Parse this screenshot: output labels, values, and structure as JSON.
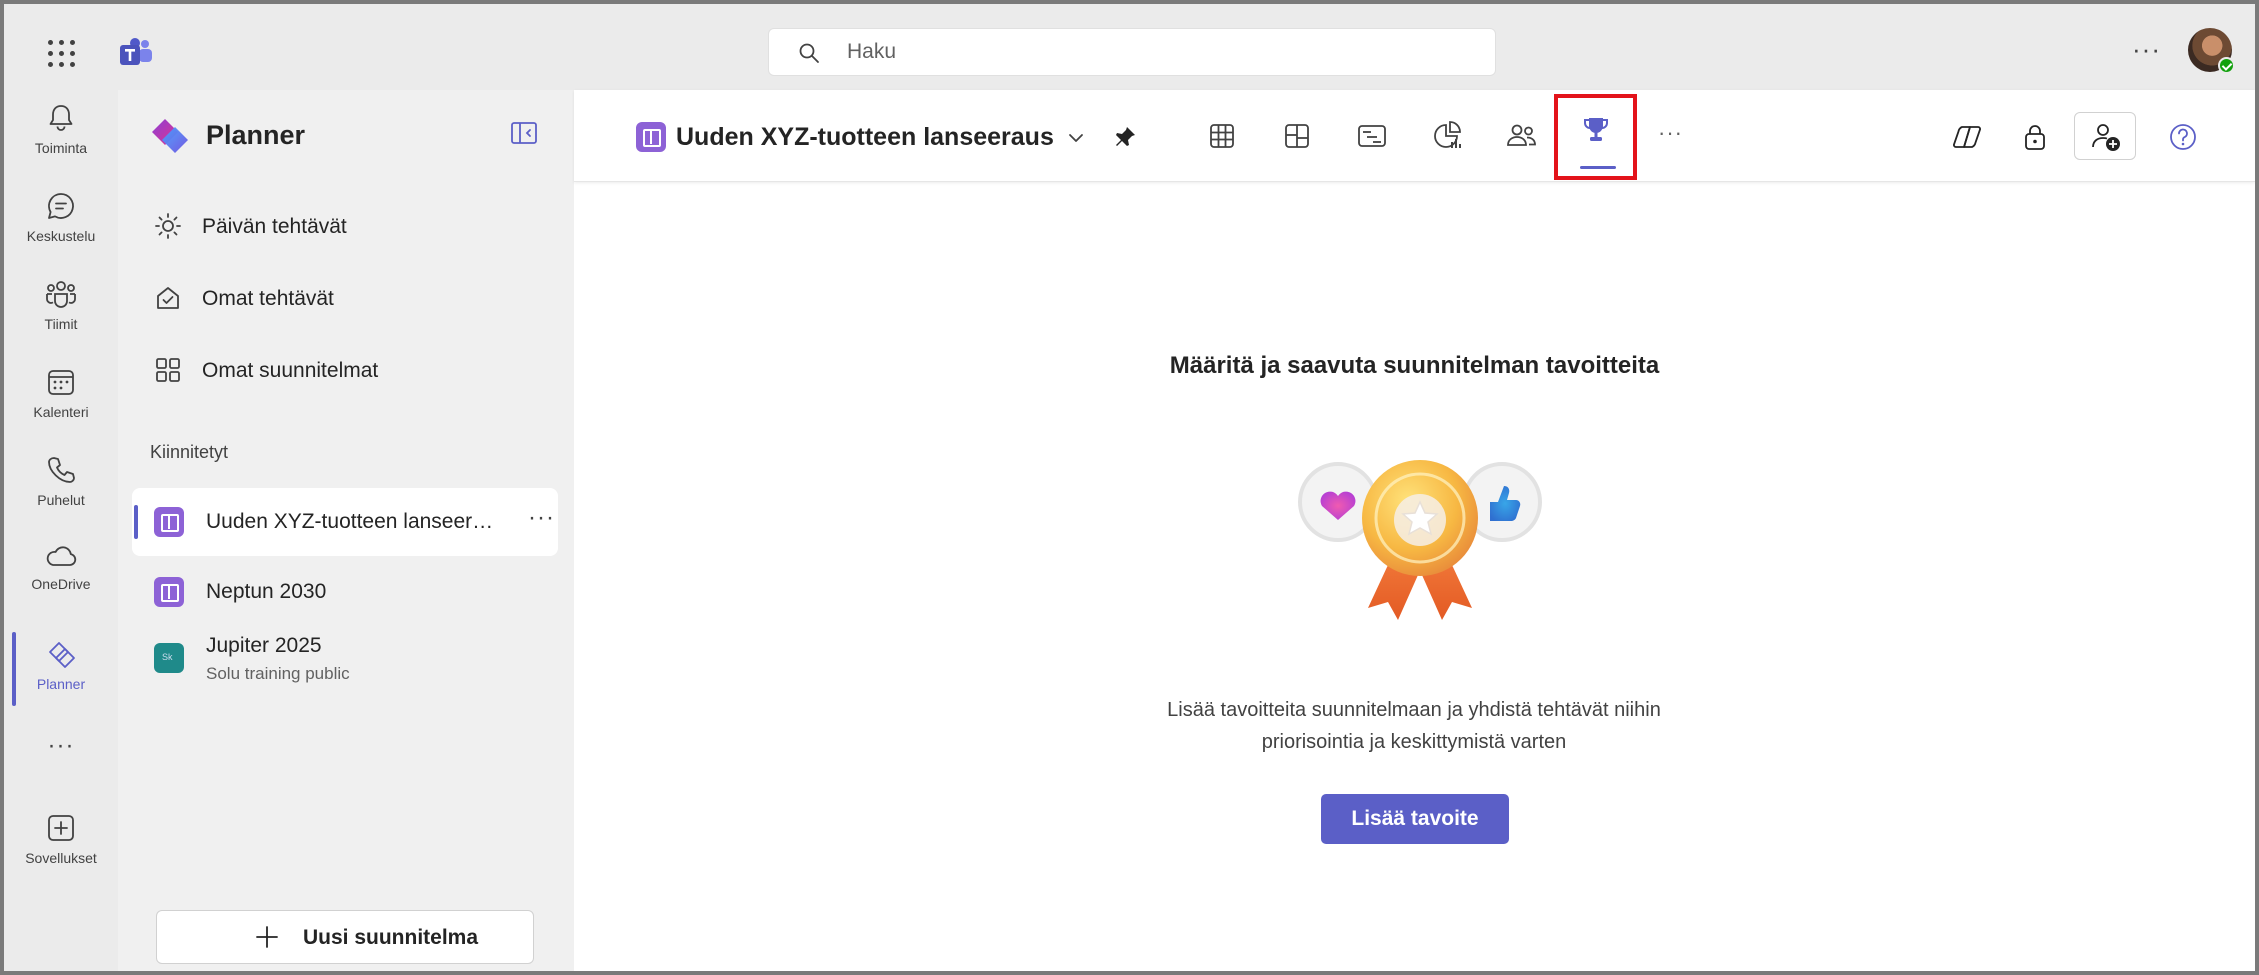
{
  "topbar": {
    "search_placeholder": "Haku",
    "more_label": "···"
  },
  "rail": {
    "items": [
      {
        "label": "Toiminta",
        "icon": "bell-icon"
      },
      {
        "label": "Keskustelu",
        "icon": "chat-icon"
      },
      {
        "label": "Tiimit",
        "icon": "teams-icon"
      },
      {
        "label": "Kalenteri",
        "icon": "calendar-icon"
      },
      {
        "label": "Puhelut",
        "icon": "phone-icon"
      },
      {
        "label": "OneDrive",
        "icon": "cloud-icon"
      },
      {
        "label": "Planner",
        "icon": "planner-icon",
        "active": true
      },
      {
        "label": "Sovellukset",
        "icon": "add-apps-icon"
      }
    ],
    "more_label": "···"
  },
  "sidebar": {
    "title": "Planner",
    "nav": [
      {
        "label": "Päivän tehtävät",
        "icon": "sun-icon"
      },
      {
        "label": "Omat tehtävät",
        "icon": "my-tasks-icon"
      },
      {
        "label": "Omat suunnitelmat",
        "icon": "grid-icon"
      }
    ],
    "pinned_heading": "Kiinnitetyt",
    "plans": [
      {
        "name": "Uuden XYZ-tuotteen lanseeraus",
        "active": true
      },
      {
        "name": "Neptun 2030"
      },
      {
        "name": "Jupiter 2025",
        "sub": "Solu training public",
        "badge": "Sk"
      }
    ],
    "plan_more_label": "···",
    "new_plan_label": "Uusi suunnitelma"
  },
  "header": {
    "plan_title": "Uuden XYZ-tuotteen lanseeraus",
    "views": [
      "grid-view-icon",
      "board-view-icon",
      "schedule-view-icon",
      "charts-view-icon",
      "people-view-icon",
      "goals-trophy-icon"
    ],
    "active_view": "goals-trophy-icon",
    "more_label": "···"
  },
  "main": {
    "empty_title": "Määritä ja saavuta suunnitelman tavoitteita",
    "empty_desc_line1": "Lisää tavoitteita suunnitelmaan ja yhdistä tehtävät niihin",
    "empty_desc_line2": "priorisointia ja keskittymistä varten",
    "add_goal_label": "Lisää tavoite"
  },
  "colors": {
    "brand": "#5b5fc7",
    "highlight": "#e3131a",
    "plan_purple": "#8d62d6",
    "plan_teal": "#1f8a8a"
  }
}
